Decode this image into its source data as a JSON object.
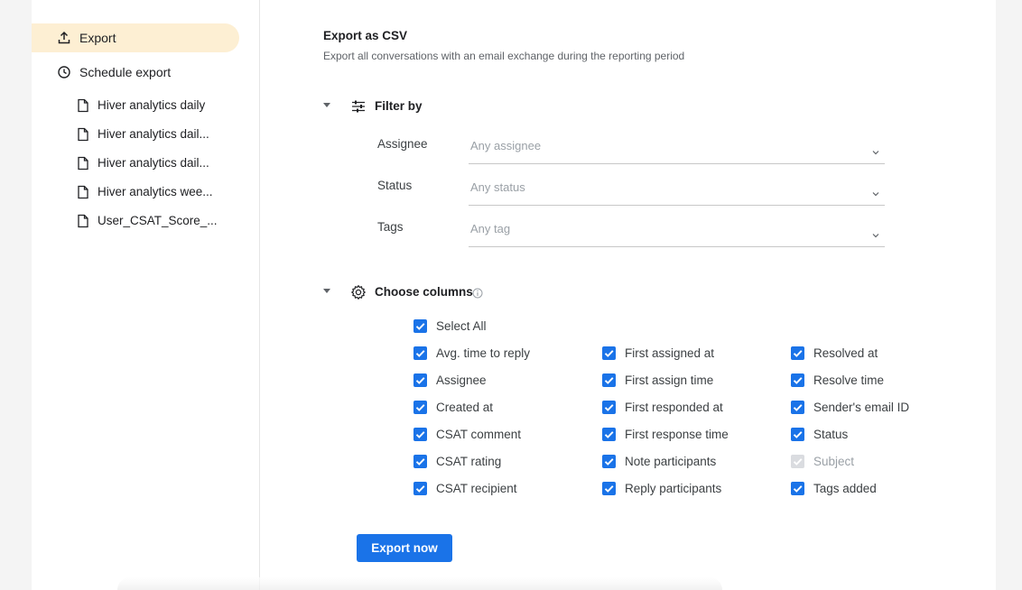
{
  "sidebar": {
    "export_label": "Export",
    "schedule_label": "Schedule export",
    "schedules": [
      "Hiver analytics daily",
      "Hiver analytics dail...",
      "Hiver analytics dail...",
      "Hiver analytics wee...",
      "User_CSAT_Score_..."
    ]
  },
  "main": {
    "title": "Export as CSV",
    "subtitle": "Export all conversations with an email exchange during the reporting period",
    "filter": {
      "label": "Filter by",
      "fields": [
        {
          "label": "Assignee",
          "placeholder": "Any assignee"
        },
        {
          "label": "Status",
          "placeholder": "Any status"
        },
        {
          "label": "Tags",
          "placeholder": "Any tag"
        }
      ]
    },
    "columns": {
      "label": "Choose columns",
      "select_all": "Select All",
      "col1": [
        "Avg. time to reply",
        "Assignee",
        "Created at",
        "CSAT comment",
        "CSAT rating",
        "CSAT recipient"
      ],
      "col2": [
        "First assigned at",
        "First assign time",
        "First responded at",
        "First response time",
        "Note participants",
        "Reply participants"
      ],
      "col3": [
        "Resolved at",
        "Resolve time",
        "Sender's email ID",
        "Status",
        "Subject",
        "Tags added"
      ]
    },
    "export_button": "Export now"
  },
  "colors": {
    "accent": "#1a73e8",
    "active_nav": "#fdefd3"
  }
}
